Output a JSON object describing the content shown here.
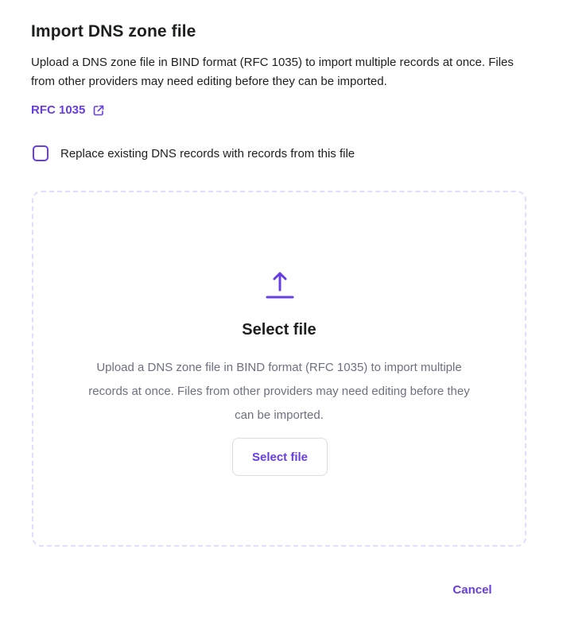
{
  "dialog": {
    "title": "Import DNS zone file",
    "description": "Upload a DNS zone file in BIND format (RFC 1035) to import multiple records at once. Files from other providers may need editing before they can be imported.",
    "rfc_link_label": "RFC 1035",
    "replace_checkbox_label": "Replace existing DNS records with records from this file",
    "replace_checked": false
  },
  "dropzone": {
    "icon": "upload-icon",
    "title": "Select file",
    "text": "Upload a DNS zone file in BIND format (RFC 1035) to import multiple records at once. Files from other providers may need editing before they can be imported.",
    "button_label": "Select file"
  },
  "footer": {
    "cancel_label": "Cancel"
  },
  "colors": {
    "accent": "#673de6",
    "text": "#1d1e20",
    "muted_text": "#6d7081",
    "dropzone_border": "#e3dcfb"
  }
}
